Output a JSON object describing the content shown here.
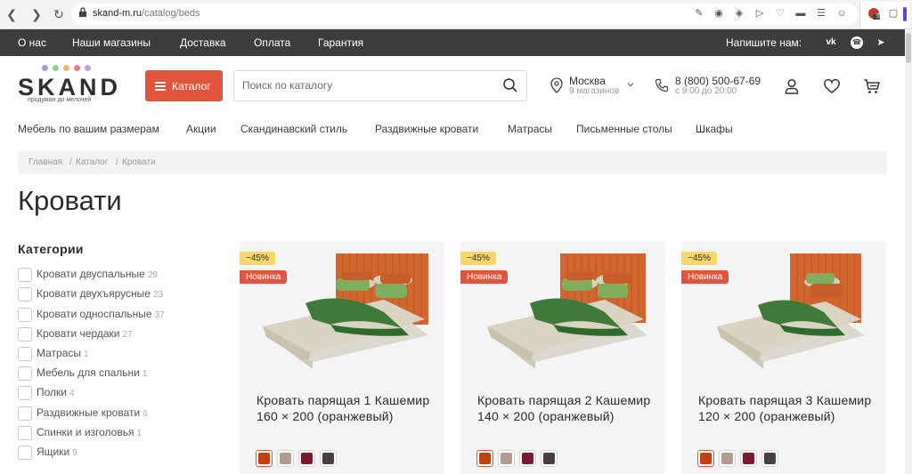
{
  "browser": {
    "url_host": "skand-m.ru",
    "url_path": "/catalog/beds",
    "extension_count": "5"
  },
  "topbar": {
    "links": [
      "О нас",
      "Наши магазины",
      "Доставка",
      "Оплата",
      "Гарантия"
    ],
    "write_us": "Напишите нам:"
  },
  "header": {
    "logo": "SKAND",
    "logo_tagline": "продуман до мелочей",
    "logo_dot_colors": [
      "#9aa4d6",
      "#8fcf9c",
      "#f2b36a",
      "#e07a86",
      "#b8a3d6"
    ],
    "catalog_button": "Каталог",
    "search_placeholder": "Поиск по каталогу",
    "city": "Москва",
    "city_stores": "9 магазинов",
    "phone": "8 (800) 500-67-69",
    "hours": "с 9:00 до 20:00"
  },
  "category_nav": [
    {
      "label": "Мебель по вашим размерам",
      "accent": true
    },
    {
      "label": "Акции",
      "accent": true
    },
    {
      "label": "Скандинавский стиль",
      "accent": false
    },
    {
      "label": "Раздвижные кровати",
      "accent": false
    },
    {
      "label": "Матрасы",
      "accent": false
    },
    {
      "label": "Письменные столы",
      "accent": false
    },
    {
      "label": "Шкафы",
      "accent": false
    }
  ],
  "breadcrumbs": [
    "Главная",
    "Каталог",
    "Кровати"
  ],
  "page_title": "Кровати",
  "sidebar": {
    "title": "Категории",
    "filters": [
      {
        "label": "Кровати двуспальные",
        "count": "29"
      },
      {
        "label": "Кровати двухъярусные",
        "count": "23"
      },
      {
        "label": "Кровати односпальные",
        "count": "37"
      },
      {
        "label": "Кровати чердаки",
        "count": "27"
      },
      {
        "label": "Матрасы",
        "count": "1"
      },
      {
        "label": "Мебель для спальни",
        "count": "1"
      },
      {
        "label": "Полки",
        "count": "4"
      },
      {
        "label": "Раздвижные кровати",
        "count": "6"
      },
      {
        "label": "Спинки и изголовья",
        "count": "1"
      },
      {
        "label": "Ящики",
        "count": "9"
      }
    ]
  },
  "products": [
    {
      "discount": "−45%",
      "badge": "Новинка",
      "title": "Кровать парящая 1 Кашемир 160 × 200 (оранжевый)"
    },
    {
      "discount": "−45%",
      "badge": "Новинка",
      "title": "Кровать парящая 2 Кашемир 140 × 200 (оранжевый)"
    },
    {
      "discount": "−45%",
      "badge": "Новинка",
      "title": "Кровать парящая 3 Кашемир 120 × 200 (оранжевый)"
    }
  ],
  "swatch_colors": [
    "#c2410c",
    "#b39b92",
    "#7a1a2c",
    "#4a3f3d"
  ],
  "colors": {
    "accent": "#e0553c",
    "topbar": "#3d3d3d",
    "sale_badge": "#f7d66a",
    "card_bg": "#f4f4f4"
  }
}
